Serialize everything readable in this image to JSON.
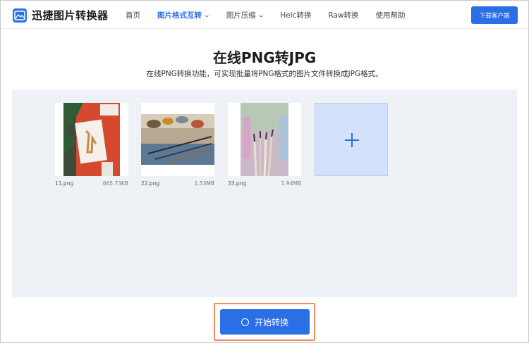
{
  "app": {
    "name": "迅捷图片转换器"
  },
  "nav": [
    {
      "label": "首页",
      "active": false,
      "dropdown": false
    },
    {
      "label": "图片格式互转",
      "active": true,
      "dropdown": true
    },
    {
      "label": "图片压缩",
      "active": false,
      "dropdown": true
    },
    {
      "label": "Heic转换",
      "active": false,
      "dropdown": false
    },
    {
      "label": "Raw转换",
      "active": false,
      "dropdown": false
    },
    {
      "label": "使用帮助",
      "active": false,
      "dropdown": false
    }
  ],
  "header": {
    "download_label": "下载客户端"
  },
  "main": {
    "title": "在线PNG转JPG",
    "subtitle": "在线PNG转换功能，可实现批量将PNG格式的图片文件转换成JPG格式。"
  },
  "files": [
    {
      "name": "11.png",
      "size": "665.73KB"
    },
    {
      "name": "22.png",
      "size": "1.53MB"
    },
    {
      "name": "33.png",
      "size": "1.94MB"
    }
  ],
  "actions": {
    "start_label": "开始转换"
  },
  "colors": {
    "accent": "#2b6fe6",
    "panel": "#eef1f6",
    "highlight": "#ef8c5f"
  }
}
